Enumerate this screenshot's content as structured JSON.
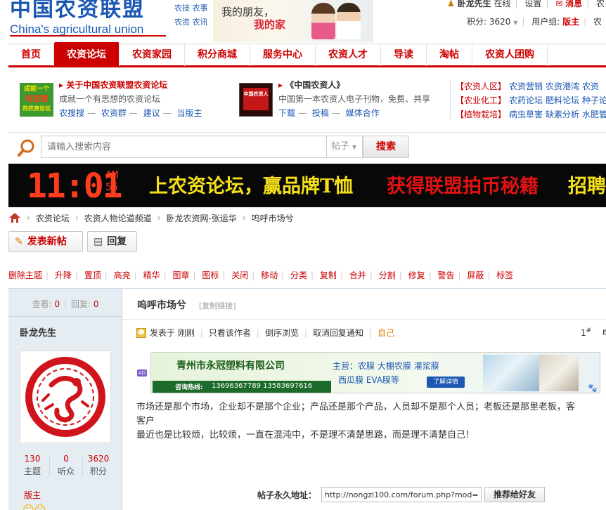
{
  "logo": {
    "cn": "中国农资联盟",
    "en": "China's agricultural union",
    "tags": [
      "农技 农事",
      "农资 农讯"
    ]
  },
  "banner": {
    "line1": "我的朋友，",
    "line2": "我的家"
  },
  "user": {
    "name": "卧龙先生",
    "status": "在线",
    "settings": "设置",
    "messages": "消息",
    "more": "农",
    "points_label": "积分: 3620",
    "group_label": "用户组:",
    "group": "版主",
    "extra": "农"
  },
  "nav": {
    "items": [
      "首页",
      "农资论坛",
      "农资家园",
      "积分商城",
      "服务中心",
      "农资人才",
      "导读",
      "淘帖",
      "农资人团购"
    ],
    "active": 1
  },
  "promo": [
    {
      "title": "关于中国农资联盟农资论坛",
      "desc": "成就一个有思想的农资论坛",
      "links": [
        "农搜搜",
        "农资群",
        "建议",
        "当版主"
      ],
      "img_text": [
        "成就一个",
        "有思想",
        "的农资论坛"
      ]
    },
    {
      "title": "《中国农资人》",
      "desc": "中国第一本农资人电子刊物，免费、共享",
      "links": [
        "下载",
        "投稿",
        "媒体合作"
      ],
      "img_text": [
        "中国农资人"
      ]
    }
  ],
  "promo_right": [
    {
      "cat": "【农资人区】",
      "links": [
        "农资营销",
        "农资港湾",
        "农资"
      ]
    },
    {
      "cat": "【农业化工】",
      "links": [
        "农药论坛",
        "肥料论坛",
        "种子论"
      ]
    },
    {
      "cat": "【植物栽培】",
      "links": [
        "病虫草害",
        "缺素分析",
        "水肥管"
      ]
    }
  ],
  "search": {
    "placeholder": "请输入搜索内容",
    "type": "帖子",
    "button": "搜索"
  },
  "led": {
    "clock": "11:01",
    "am": "AM",
    "sec": "55",
    "msg1": "上农资论坛，赢品牌T恤",
    "msg2": "获得联盟拍币秘籍",
    "msg3": "招聘"
  },
  "breadcrumb": [
    "农资论坛",
    "农资人物论道频道",
    "卧龙农资网-张运华",
    "呜呼市场兮"
  ],
  "actions": {
    "new_post": "发表新帖",
    "reply": "回复"
  },
  "mod_tools": [
    "删除主题",
    "升降",
    "置顶",
    "高亮",
    "精华",
    "图章",
    "图标",
    "关闭",
    "移动",
    "分类",
    "复制",
    "合并",
    "分割",
    "修复",
    "警告",
    "屏蔽",
    "标签"
  ],
  "thread_stats": {
    "views_label": "查看:",
    "views": "0",
    "replies_label": "回复:",
    "replies": "0"
  },
  "author": {
    "name": "卧龙先生",
    "stats": [
      {
        "n": "130",
        "l": "主题"
      },
      {
        "n": "0",
        "l": "听众"
      },
      {
        "n": "3620",
        "l": "积分"
      }
    ],
    "role": "版主"
  },
  "post": {
    "title": "呜呼市场兮",
    "copy_link": "[复制链接]",
    "meta": [
      "发表于 刚刚",
      "只看该作者",
      "倒序浏览",
      "取消回复通知",
      "自己"
    ],
    "floor": "1",
    "floor_sup": "#",
    "floor_extra": "电",
    "body": [
      "市场还是那个市场，企业却不是那个企业；产品还是那个产品，人员却不是那个人员；老板还是那里老板，客",
      "客户",
      "最近也是比较烦，比较烦，一直在混沌中，不是理不清楚思路，而是理不清楚自己！"
    ]
  },
  "ad": {
    "tag": "AD",
    "company": "青州市永冠塑料有限公司",
    "hotline_label": "咨询热线:",
    "phones": "13696367789 13583697616",
    "products1": "主营：农膜 大棚农膜 灌浆膜",
    "products2": "西瓜膜  EVA膜等",
    "more": "了解详情"
  },
  "permalink": {
    "label": "帖子永久地址：",
    "url": "http://nongzi100.com/forum.php?mod=",
    "button": "推荐给好友"
  },
  "colors": {
    "brand_red": "#cc0000",
    "brand_blue": "#1b57b3",
    "author_panel": "#e5edf2"
  }
}
